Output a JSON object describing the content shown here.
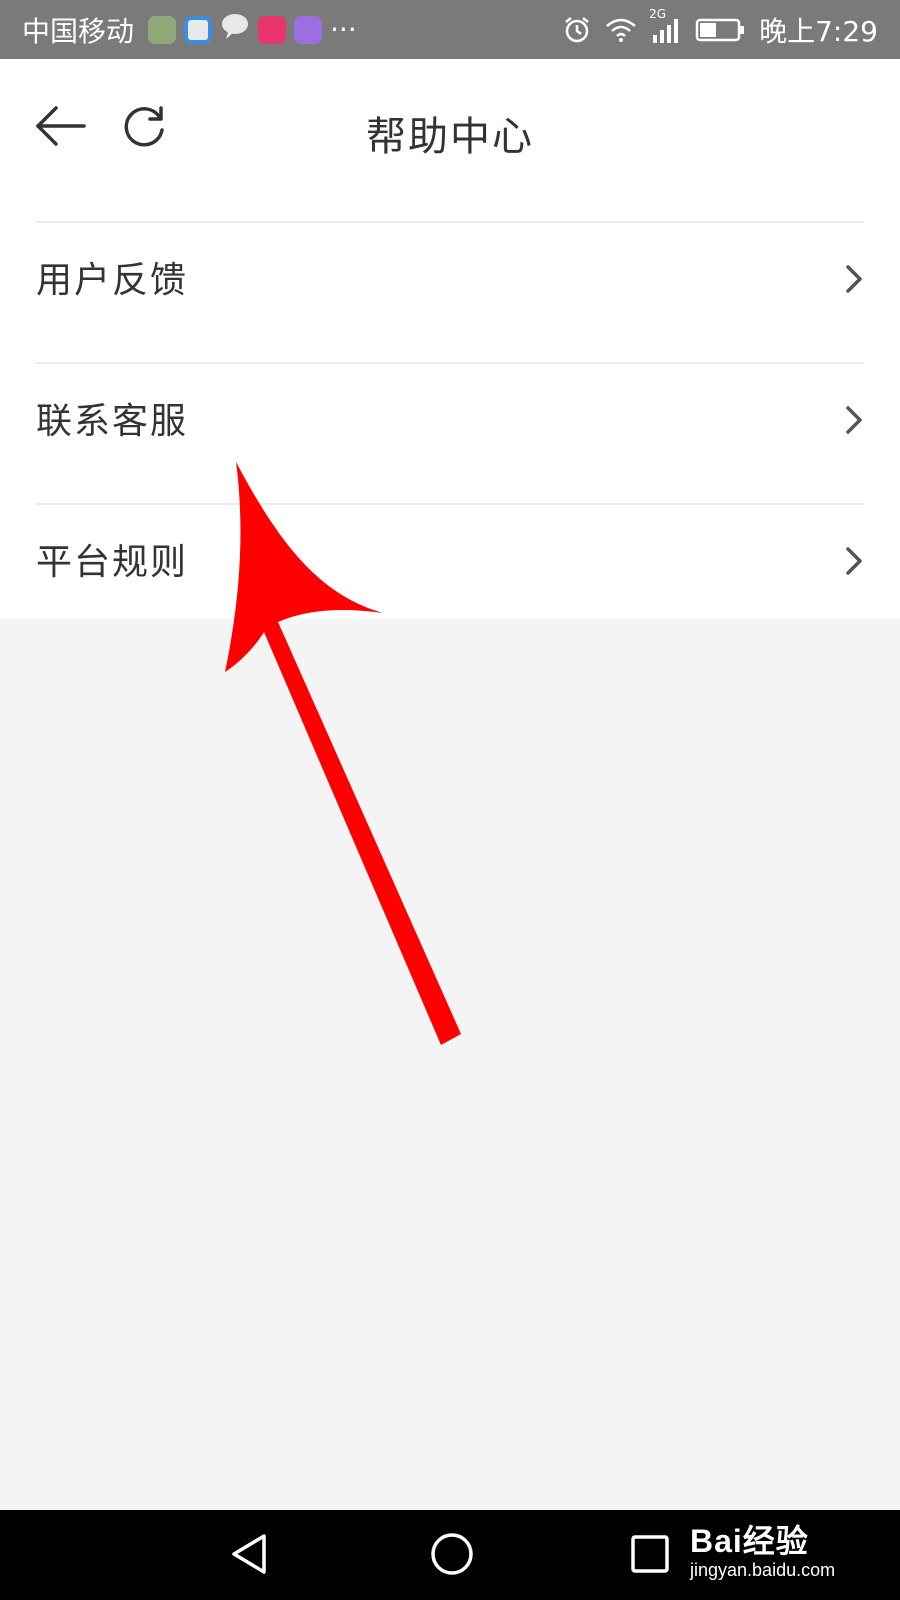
{
  "status_bar": {
    "carrier": "中国移动",
    "more": "···",
    "time": "晚上7:29",
    "network": "2G",
    "icons": [
      "app-icon-1",
      "app-icon-2",
      "message-icon",
      "app-icon-3",
      "app-icon-4",
      "alarm-icon",
      "wifi-icon",
      "signal-icon",
      "battery-icon"
    ]
  },
  "header": {
    "title": "帮助中心",
    "back_icon": "arrow-left-icon",
    "refresh_icon": "refresh-icon"
  },
  "menu": {
    "items": [
      {
        "label": "用户反馈"
      },
      {
        "label": "联系客服"
      },
      {
        "label": "平台规则"
      }
    ]
  },
  "nav_bar": {
    "icons": [
      "back-triangle-icon",
      "home-circle-icon",
      "recent-square-icon"
    ]
  },
  "watermark": {
    "logo": "Bai经验",
    "url": "jingyan.baidu.com"
  },
  "colors": {
    "status_bar": "#7a7a7a",
    "background": "#f4f4f4",
    "annotation_arrow": "#ff0000",
    "text": "#333333"
  }
}
